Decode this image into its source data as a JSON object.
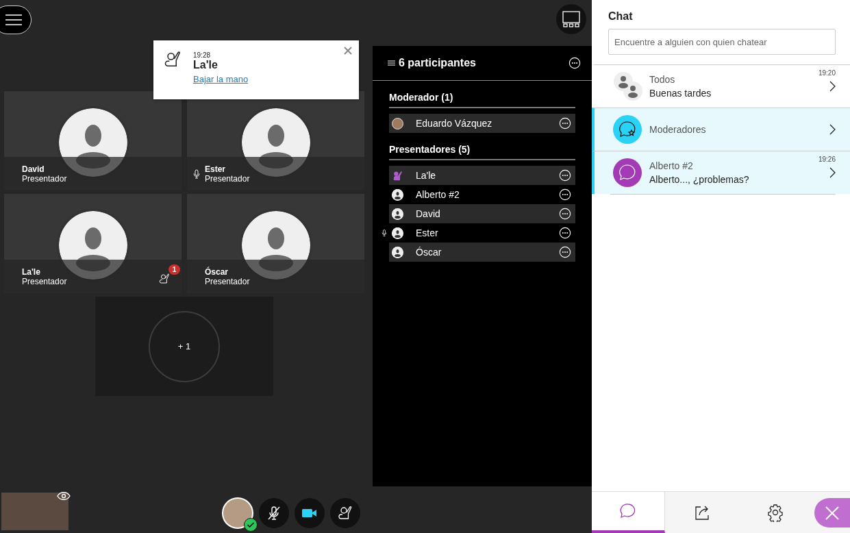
{
  "stage": {
    "notification": {
      "time": "19:28",
      "name": "La'le",
      "action": "Bajar la mano"
    },
    "tiles": [
      {
        "name": "David",
        "role": "Presentador",
        "mic": false
      },
      {
        "name": "Ester",
        "role": "Presentador",
        "mic": true
      },
      {
        "name": "La'le",
        "role": "Presentador",
        "mic": false,
        "hand_count": "1"
      },
      {
        "name": "Óscar",
        "role": "Presentador",
        "mic": false
      }
    ],
    "overflow": "+ 1"
  },
  "controls": {
    "mic_muted": true,
    "status_ok": true
  },
  "participants": {
    "title": "6 participantes",
    "groups": [
      {
        "title": "Moderador (1)",
        "members": [
          {
            "name": "Eduardo Vázquez",
            "kind": "photo",
            "mic": false
          }
        ]
      },
      {
        "title": "Presentadores (5)",
        "members": [
          {
            "name": "La'le",
            "kind": "hand",
            "mic": false
          },
          {
            "name": "Alberto #2",
            "kind": "person",
            "mic": false
          },
          {
            "name": "David",
            "kind": "person",
            "mic": false
          },
          {
            "name": "Ester",
            "kind": "person",
            "mic": true
          },
          {
            "name": "Óscar",
            "kind": "person",
            "mic": false
          }
        ]
      }
    ]
  },
  "chat": {
    "title": "Chat",
    "search": {
      "placeholder": "Encuentre a alguien con quien chatear"
    },
    "conversations": [
      {
        "kind": "group",
        "name": "Todos",
        "time": "19:20",
        "preview": "Buenas tardes",
        "highlighted": false
      },
      {
        "kind": "moderators",
        "name": "Moderadores",
        "color": "#2ad2f5",
        "highlighted": true
      },
      {
        "kind": "person",
        "name": "Alberto #2",
        "time": "19:26",
        "preview": "Alberto..., ¿problemas?",
        "color": "#a23bb5",
        "highlighted": true
      }
    ]
  },
  "tabs": [
    {
      "kind": "chat",
      "selected": true
    },
    {
      "kind": "share",
      "selected": false
    },
    {
      "kind": "settings",
      "selected": false
    }
  ]
}
